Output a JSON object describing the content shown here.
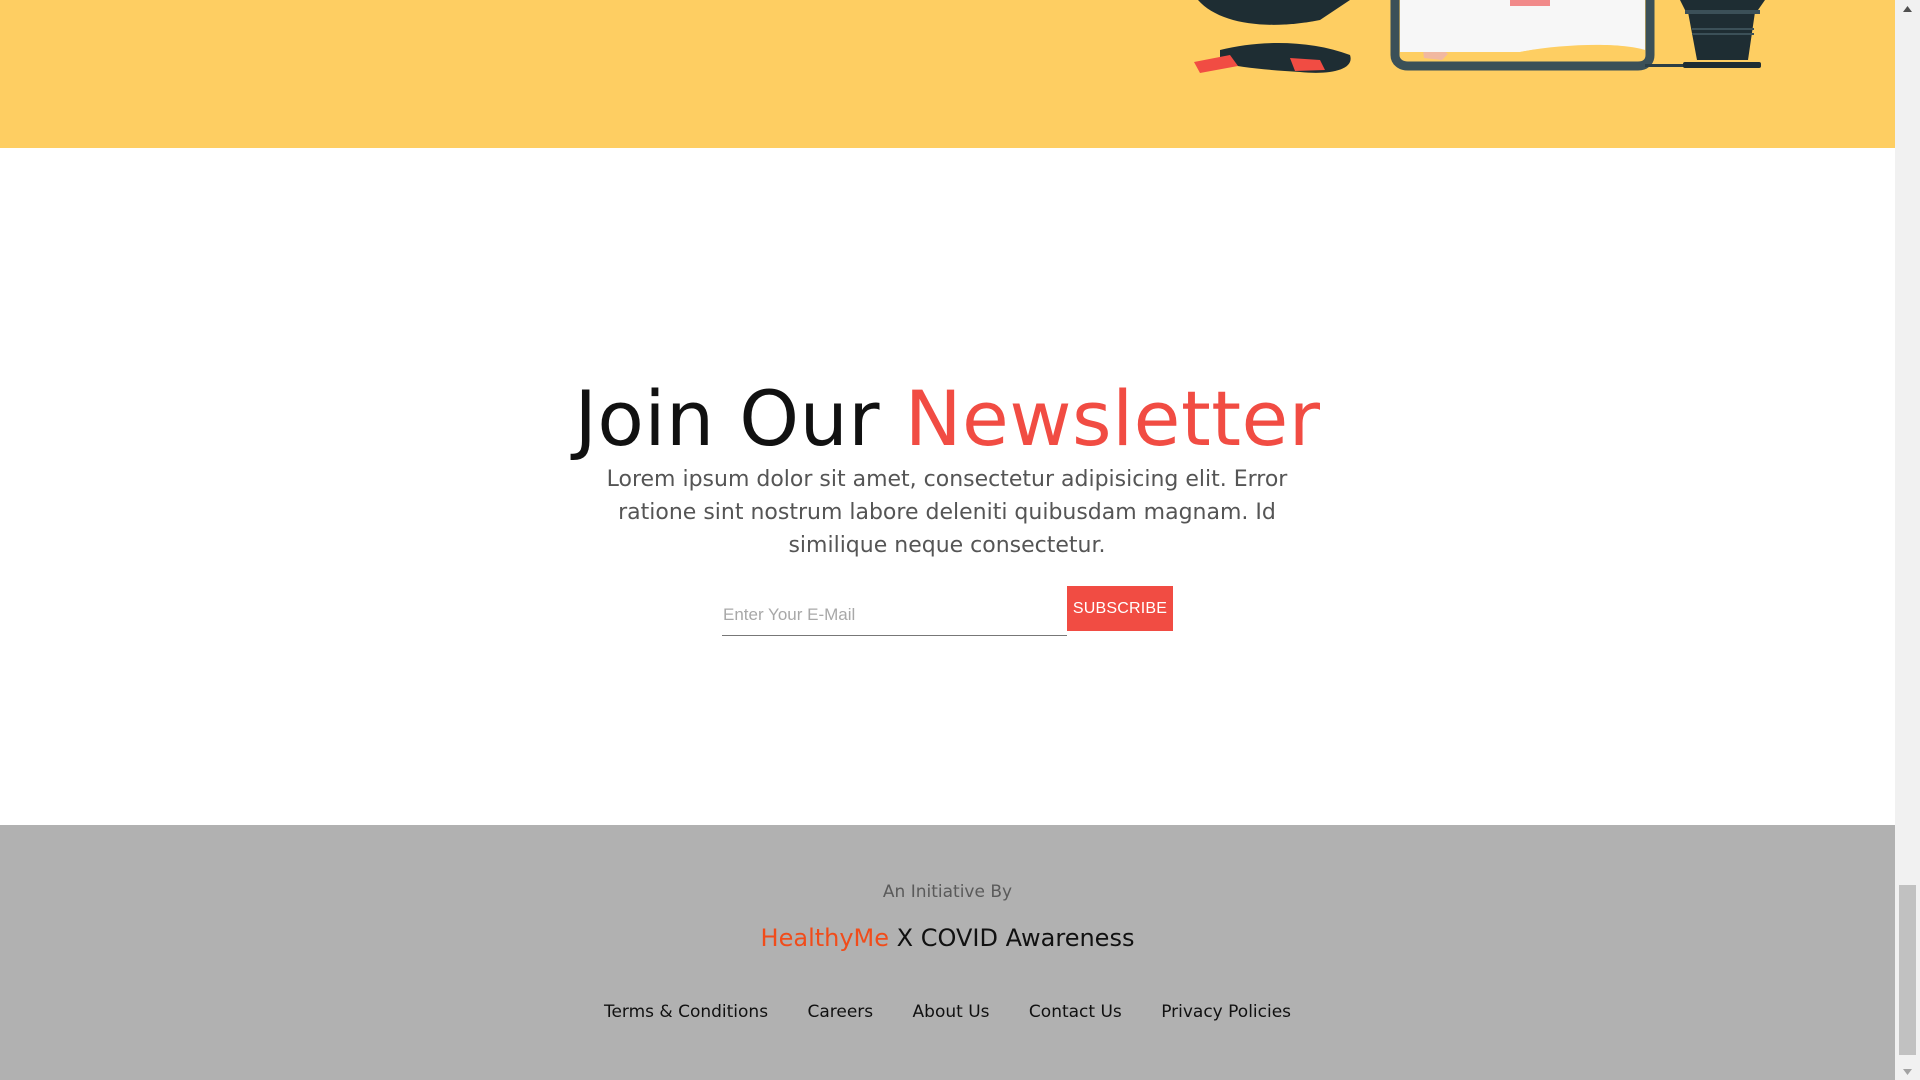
{
  "newsletter": {
    "title_part1": "Join Our",
    "title_part2": "Newsletter",
    "description": "Lorem ipsum dolor sit amet, consectetur adipisicing elit. Error ratione sint nostrum labore deleniti quibusdam magnam. Id similique neque consectetur.",
    "email_placeholder": "Enter Your E-Mail",
    "email_value": "",
    "subscribe_label": "SUBSCRIBE"
  },
  "footer": {
    "initiative_label": "An Initiative By",
    "brand_accent": "HealthyMe",
    "brand_rest": "X COVID Awareness",
    "links": [
      {
        "label": "Terms & Conditions"
      },
      {
        "label": "Careers"
      },
      {
        "label": "About Us"
      },
      {
        "label": "Contact Us"
      },
      {
        "label": "Privacy Policies"
      }
    ]
  },
  "icons": {
    "scroll_up": "scroll-up-arrow-icon",
    "scroll_down": "scroll-down-arrow-icon",
    "hero_art": "person-with-laptop-and-plant-illustration"
  },
  "colors": {
    "hero_background": "#fece62",
    "accent": "#f14c43",
    "footer_background": "#b1b1b1",
    "brand_accent": "#f14c1a"
  }
}
